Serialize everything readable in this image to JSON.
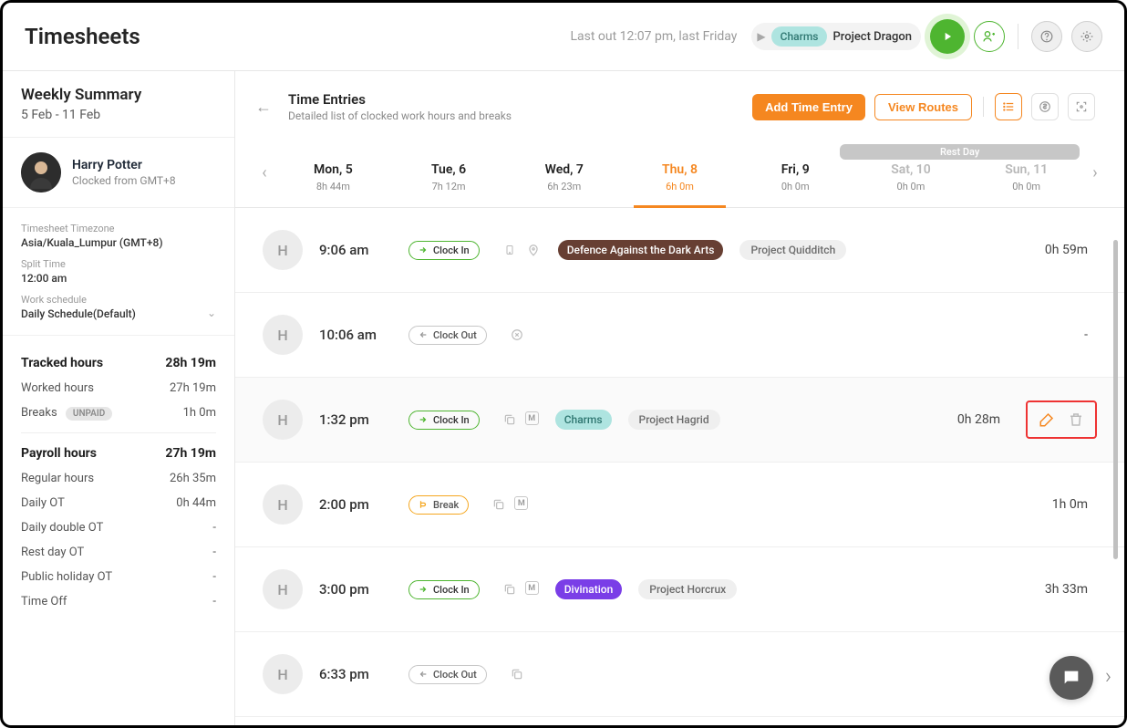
{
  "header": {
    "title": "Timesheets",
    "last_out": "Last out 12:07 pm, last Friday",
    "tracker_tag": "Charms",
    "tracker_project": "Project Dragon"
  },
  "sidebar": {
    "summary_title": "Weekly Summary",
    "summary_range": "5 Feb - 11 Feb",
    "user_name": "Harry Potter",
    "user_sub": "Clocked from GMT+8",
    "tz_label": "Timesheet Timezone",
    "tz_value": "Asia/Kuala_Lumpur (GMT+8)",
    "split_label": "Split Time",
    "split_value": "12:00 am",
    "sched_label": "Work schedule",
    "sched_value": "Daily Schedule(Default)",
    "tracked_label": "Tracked hours",
    "tracked_value": "28h 19m",
    "worked_label": "Worked hours",
    "worked_value": "27h 19m",
    "breaks_label": "Breaks",
    "breaks_badge": "UNPAID",
    "breaks_value": "1h 0m",
    "payroll_label": "Payroll hours",
    "payroll_value": "27h 19m",
    "regular_label": "Regular hours",
    "regular_value": "26h 35m",
    "dailyot_label": "Daily OT",
    "dailyot_value": "0h 44m",
    "ddot_label": "Daily double OT",
    "ddot_value": "-",
    "restot_label": "Rest day OT",
    "restot_value": "-",
    "phot_label": "Public holiday OT",
    "phot_value": "-",
    "timeoff_label": "Time Off",
    "timeoff_value": "-"
  },
  "mainheader": {
    "title": "Time Entries",
    "subtitle": "Detailed list of clocked work hours and breaks",
    "add_btn": "Add Time Entry",
    "routes_btn": "View Routes"
  },
  "rest_day_label": "Rest Day",
  "days": [
    {
      "label": "Mon, 5",
      "hours": "8h 44m"
    },
    {
      "label": "Tue, 6",
      "hours": "7h 12m"
    },
    {
      "label": "Wed, 7",
      "hours": "6h 23m"
    },
    {
      "label": "Thu, 8",
      "hours": "6h 0m"
    },
    {
      "label": "Fri, 9",
      "hours": "0h 0m"
    },
    {
      "label": "Sat, 10",
      "hours": "0h 0m"
    },
    {
      "label": "Sun, 11",
      "hours": "0h 0m"
    }
  ],
  "entries": [
    {
      "initial": "H",
      "time": "9:06 am",
      "type": "Clock In",
      "type_class": "in",
      "tag": "Defence Against the Dark Arts",
      "tag_class": "dada",
      "project": "Project Quidditch",
      "duration": "0h 59m",
      "icons": [
        "device",
        "pin"
      ]
    },
    {
      "initial": "H",
      "time": "10:06 am",
      "type": "Clock Out",
      "type_class": "out",
      "duration": "-",
      "icons": [
        "stop"
      ]
    },
    {
      "initial": "H",
      "time": "1:32 pm",
      "type": "Clock In",
      "type_class": "in",
      "tag": "Charms",
      "tag_class": "charms",
      "project": "Project Hagrid",
      "duration": "0h 28m",
      "icons": [
        "copy",
        "m"
      ],
      "highlight": true,
      "actions": true
    },
    {
      "initial": "H",
      "time": "2:00 pm",
      "type": "Break",
      "type_class": "break",
      "duration": "1h 0m",
      "icons": [
        "copy",
        "m"
      ]
    },
    {
      "initial": "H",
      "time": "3:00 pm",
      "type": "Clock In",
      "type_class": "in",
      "tag": "Divination",
      "tag_class": "divination",
      "project": "Project Horcrux",
      "duration": "3h 33m",
      "icons": [
        "copy",
        "m"
      ]
    },
    {
      "initial": "H",
      "time": "6:33 pm",
      "type": "Clock Out",
      "type_class": "out",
      "duration": "-",
      "icons": [
        "copy"
      ]
    }
  ]
}
